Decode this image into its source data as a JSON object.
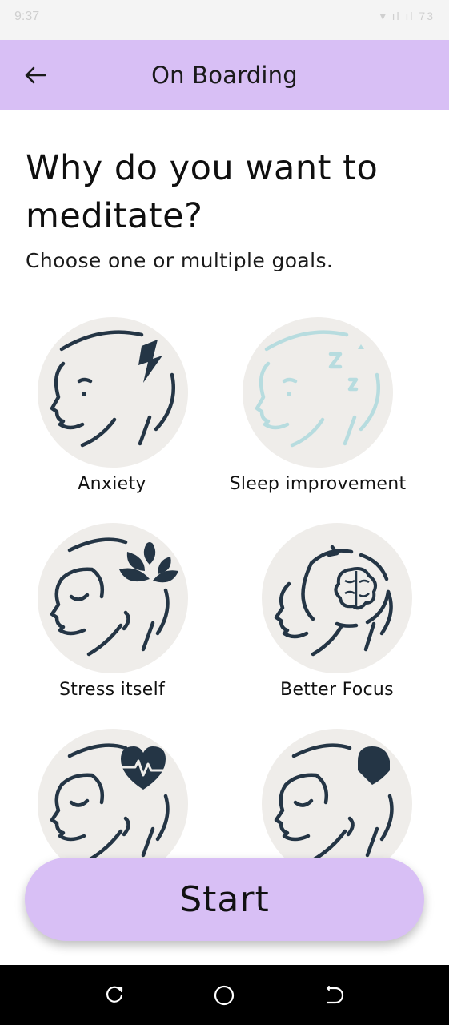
{
  "status_bar": {
    "time": "9:37",
    "indicators": "▾ ıl ıl 73"
  },
  "app_bar": {
    "title": "On Boarding",
    "back_icon": "arrow-left-icon"
  },
  "main": {
    "heading": "Why do you want to meditate?",
    "subheading": "Choose one or multiple goals."
  },
  "goals": [
    {
      "label": "Anxiety",
      "icon": "head-lightning-icon",
      "accent": "#243545"
    },
    {
      "label": "Sleep improvement",
      "icon": "head-sleep-icon",
      "accent": "#b7dcdf"
    },
    {
      "label": "Stress itself",
      "icon": "head-lotus-icon",
      "accent": "#243545"
    },
    {
      "label": "Better Focus",
      "icon": "head-brain-icon",
      "accent": "#243545"
    },
    {
      "label": "",
      "icon": "head-heartbeat-icon",
      "accent": "#243545"
    },
    {
      "label": "",
      "icon": "head-pill-icon",
      "accent": "#243545"
    }
  ],
  "start_button": {
    "label": "Start"
  },
  "colors": {
    "brand": "#d8bff5",
    "circle_bg": "#efedea",
    "icon_dark": "#243545",
    "icon_light": "#b7dcdf"
  },
  "nav_bar": {
    "buttons": [
      "recent-apps-icon",
      "home-icon",
      "back-nav-icon"
    ]
  }
}
